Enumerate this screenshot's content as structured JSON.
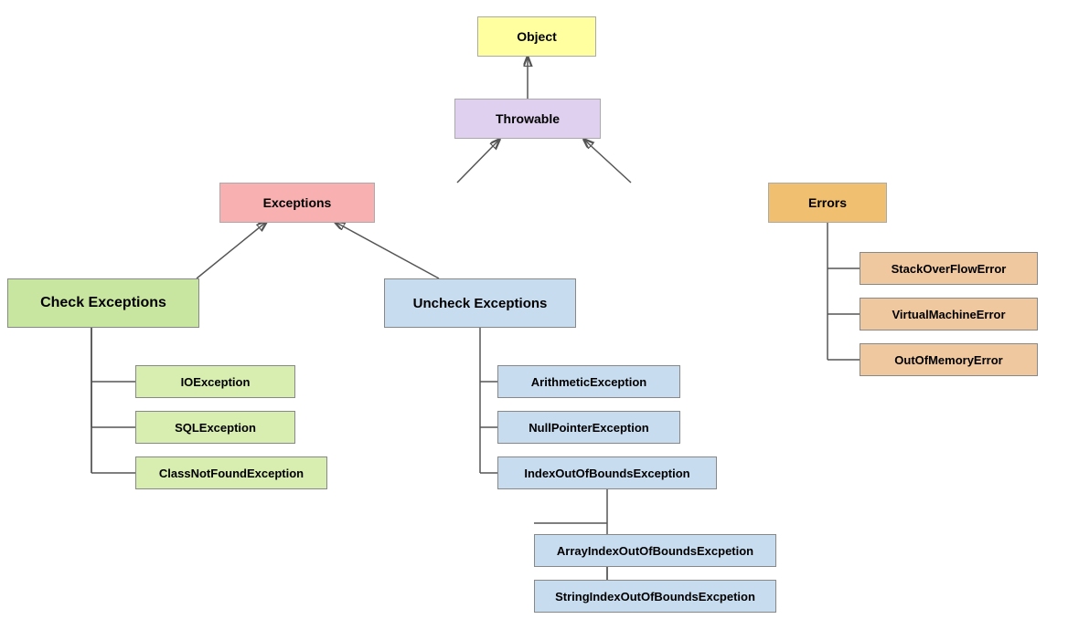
{
  "nodes": {
    "object": "Object",
    "throwable": "Throwable",
    "exceptions": "Exceptions",
    "errors": "Errors",
    "check_exceptions": "Check Exceptions",
    "uncheck_exceptions": "Uncheck Exceptions",
    "ioexception": "IOException",
    "sqlexception": "SQLException",
    "classnotfound": "ClassNotFoundException",
    "arithmetic": "ArithmeticException",
    "nullpointer": "NullPointerException",
    "indexoutofbounds": "IndexOutOfBoundsException",
    "arrayindex": "ArrayIndexOutOfBoundsExcpetion",
    "stringindex": "StringIndexOutOfBoundsExcpetion",
    "stackoverflow": "StackOverFlowError",
    "virtualmachine": "VirtualMachineError",
    "outofmemory": "OutOfMemoryError"
  }
}
